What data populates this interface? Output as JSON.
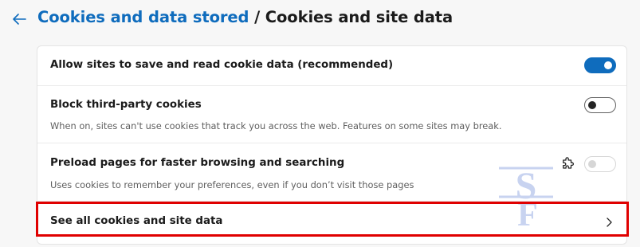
{
  "header": {
    "back_icon": "back-arrow-icon",
    "breadcrumb_parent": "Cookies and data stored",
    "breadcrumb_separator": " / ",
    "breadcrumb_current": "Cookies and site data"
  },
  "settings": [
    {
      "label": "Allow sites to save and read cookie data (recommended)",
      "description": "",
      "toggle": "on"
    },
    {
      "label": "Block third-party cookies",
      "description": "When on, sites can't use cookies that track you across the web. Features on some sites may break.",
      "toggle": "off"
    },
    {
      "label": "Preload pages for faster browsing and searching",
      "description": "Uses cookies to remember your preferences, even if you don’t visit those pages",
      "toggle": "disabled",
      "managed_icon": "puzzle-policy-icon"
    }
  ],
  "link_row": {
    "label": "See all cookies and site data",
    "icon": "chevron-right-icon"
  },
  "colors": {
    "accent": "#0f6cbd",
    "highlight": "#e00000",
    "watermark": "#c8d3f0"
  },
  "watermark": {
    "icon": "sf-watermark-logo",
    "text": "SF"
  }
}
